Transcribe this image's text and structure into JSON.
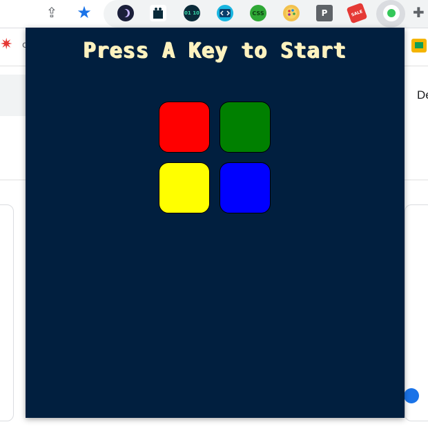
{
  "browser": {
    "extensions": [
      {
        "name": "moon-extension-icon"
      },
      {
        "name": "shopping-bag-extension-icon"
      },
      {
        "name": "binary-extension-icon",
        "label": "01 10"
      },
      {
        "name": "code-extension-icon"
      },
      {
        "name": "css-extension-icon",
        "label": "CSS"
      },
      {
        "name": "palette-extension-icon"
      },
      {
        "name": "p-extension-icon",
        "label": "P"
      },
      {
        "name": "sale-tag-extension-icon",
        "label": "SALE"
      },
      {
        "name": "simon-game-extension-icon"
      }
    ],
    "page_text_right": "De"
  },
  "game": {
    "title": "Press A Key to Start",
    "background_color": "#011f3f",
    "title_color": "#fef2bf",
    "pads": [
      {
        "name": "red-pad",
        "color": "#ff0000"
      },
      {
        "name": "green-pad",
        "color": "#008000"
      },
      {
        "name": "yellow-pad",
        "color": "#ffff00"
      },
      {
        "name": "blue-pad",
        "color": "#0000ff"
      }
    ]
  }
}
